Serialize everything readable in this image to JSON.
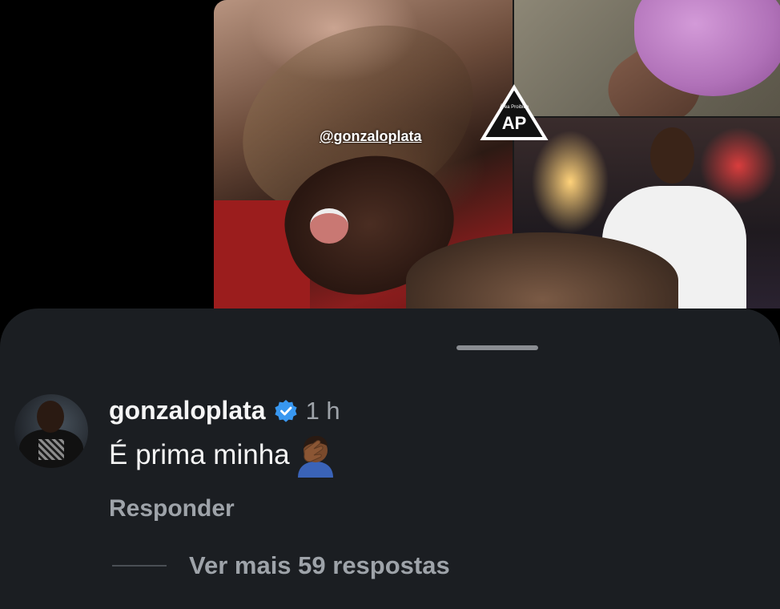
{
  "story": {
    "mention_tag": "@gonzaloplata",
    "watermark": {
      "small_text": "Área Proibida",
      "logo_text": "AP"
    }
  },
  "comments_sheet": {
    "comment": {
      "username": "gonzaloplata",
      "verified": true,
      "time": "1 h",
      "text": "É prima minha",
      "emoji": "facepalm-person-dark-skin",
      "reply_label": "Responder"
    },
    "view_more_label": "Ver mais 59 respostas"
  },
  "colors": {
    "sheet_background": "#1b1e22",
    "primary_text": "#f5f5f5",
    "secondary_text": "#9ea3a9",
    "verified_blue": "#3897f0"
  }
}
